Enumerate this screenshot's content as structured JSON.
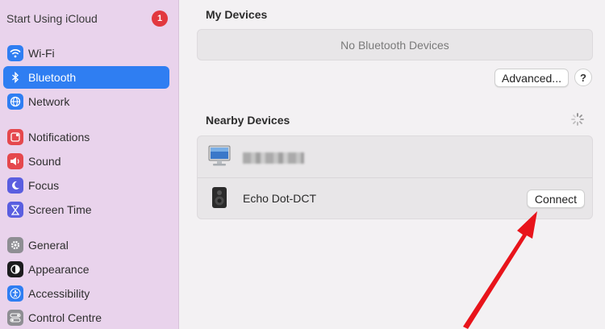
{
  "sidebar": {
    "icloud": {
      "label": "Start Using iCloud",
      "badge": "1"
    },
    "items": [
      {
        "label": "Wi-Fi",
        "icon": "wifi-icon",
        "color": "#2f7ef2"
      },
      {
        "label": "Bluetooth",
        "icon": "bluetooth-icon",
        "color": "#2f7ef2",
        "selected": true
      },
      {
        "label": "Network",
        "icon": "globe-icon",
        "color": "#2f7ef2"
      },
      {
        "label": "Notifications",
        "icon": "bell-icon",
        "color": "#e5484d"
      },
      {
        "label": "Sound",
        "icon": "speaker-icon",
        "color": "#e5484d"
      },
      {
        "label": "Focus",
        "icon": "moon-icon",
        "color": "#5a5ee0"
      },
      {
        "label": "Screen Time",
        "icon": "hourglass-icon",
        "color": "#5a5ee0"
      },
      {
        "label": "General",
        "icon": "gear-icon",
        "color": "#8e8e93"
      },
      {
        "label": "Appearance",
        "icon": "appearance-icon",
        "color": "#1c1c1e"
      },
      {
        "label": "Accessibility",
        "icon": "accessibility-icon",
        "color": "#2f7ef2"
      },
      {
        "label": "Control Centre",
        "icon": "control-centre-icon",
        "color": "#8e8e93"
      }
    ]
  },
  "main": {
    "my_devices": {
      "title": "My Devices",
      "empty_text": "No Bluetooth Devices"
    },
    "advanced_label": "Advanced...",
    "help_label": "?",
    "nearby": {
      "title": "Nearby Devices",
      "devices": [
        {
          "name": "",
          "icon": "monitor-icon",
          "blurred": true
        },
        {
          "name": "Echo Dot-DCT",
          "icon": "speaker-device-icon",
          "action": "Connect"
        }
      ]
    }
  },
  "colors": {
    "accent": "#2f7ef2",
    "arrow": "#e8141b",
    "sidebar_bg": "#e9d3ec"
  }
}
